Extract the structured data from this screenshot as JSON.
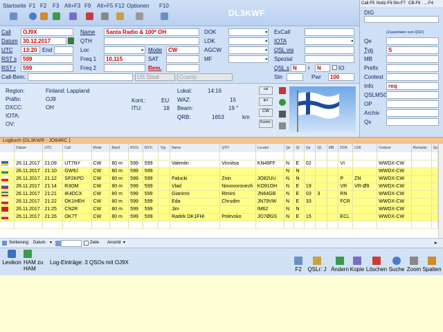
{
  "menu": {
    "items": [
      "Startseite",
      "F1",
      "F2",
      "F3",
      "Alt+F3",
      "F9",
      "Alt+F5",
      "F12",
      "Optionen",
      "F10"
    ]
  },
  "station_callsign": "DL3KWF",
  "form": {
    "call": {
      "label": "Call",
      "value": "OJ9X"
    },
    "datum": {
      "label": "Datum",
      "value": "30.12.2017"
    },
    "utc": {
      "label": "UTC",
      "value": "13:20",
      "end_label": "End"
    },
    "rst_s": {
      "label": "RST s",
      "value": "599"
    },
    "rst_r": {
      "label": "RST r",
      "value": "599"
    },
    "call_bem": {
      "label": "Call-Bem.",
      "value": ""
    },
    "name": {
      "label": "Name",
      "value": "Santa Radio & 100* OH"
    },
    "qth": {
      "label": "QTH",
      "value": ""
    },
    "loc": {
      "label": "Loc",
      "value": ""
    },
    "freq1": {
      "label": "Freq 1",
      "value": "10,115"
    },
    "freq2": {
      "label": "Freq 2",
      "value": ""
    },
    "mode": {
      "label": "Mode",
      "value": "CW"
    },
    "sat": {
      "label": "SAT",
      "value": ""
    },
    "rem": {
      "label": "Rem.",
      "value": ""
    },
    "dok": {
      "label": "DOK",
      "value": ""
    },
    "ldk": {
      "label": "LDK",
      "value": ""
    },
    "agcw": {
      "label": "AGCW",
      "value": ""
    },
    "mf": {
      "label": "MF",
      "value": ""
    },
    "us_staat": {
      "label": "US Staat"
    },
    "county": {
      "label": "County"
    },
    "excall": {
      "label": "ExCall",
      "value": ""
    },
    "iota": {
      "label": "IOTA",
      "value": ""
    },
    "qsl_via": {
      "label": "QSL via",
      "value": ""
    },
    "spezial": {
      "label": "Spezial",
      "value": ""
    },
    "qsl_s": {
      "label": "QSL s",
      "value": "N"
    },
    "qsl_r": {
      "label": "r",
      "value": "N"
    },
    "io_label": "IO",
    "stn": {
      "label": "Stn",
      "value": ""
    },
    "pwr": {
      "label": "Pwr",
      "value": "100"
    }
  },
  "right_panel": {
    "tabs": [
      "Call-F5",
      "Notiz-F6",
      "Stn-F7",
      "CB-F8",
      "...-F4"
    ],
    "dig_label": "DIG",
    "zusatz_label": "(Zusatzdaten zum QSO)",
    "fields": [
      {
        "label": "Qe",
        "value": ""
      },
      {
        "label": "Typ",
        "value": "S"
      },
      {
        "label": "MB",
        "value": ""
      },
      {
        "label": "Prefix",
        "value": ""
      },
      {
        "label": "Contest",
        "value": ""
      },
      {
        "label": "Info",
        "value": "req"
      },
      {
        "label": "QSLMSG",
        "value": ""
      },
      {
        "label": "OP",
        "value": ""
      },
      {
        "label": "Archiv",
        "value": ""
      },
      {
        "label": "Qx",
        "value": ""
      }
    ]
  },
  "info": {
    "region_label": "Region:",
    "region": "Finland: Lappland",
    "praefix_label": "Präfix:",
    "praefix": "OJ9",
    "dxcc_label": "DXCC:",
    "dxcc": "OH",
    "iota_label": "IOTA:",
    "ov_label": "OV:",
    "kont_label": "Kont.:",
    "kont": "EU",
    "itu_label": "ITU:",
    "itu": "18",
    "lokal_label": "Lokal:",
    "lokal": "14:16",
    "waz_label": "WAZ:",
    "waz": "15",
    "beam_label": "Beam:",
    "beam": "19 °",
    "qrb_label": "QRB:",
    "qrb": "1653",
    "qrb_unit": "km",
    "side_buttons": [
      "cal",
      "qrz",
      "CW",
      "Komm."
    ]
  },
  "log": {
    "title": "Logbuch  (DL3KWR - JO64RC )",
    "columns": [
      "",
      "Datum",
      "UTC",
      "Call",
      "Mode",
      "Band",
      "RSTs",
      "RSTr",
      "Typ",
      "Name",
      "QTH",
      "Locator",
      "Qs",
      "Qr",
      "Qe",
      "Q1",
      "MB",
      "DOK",
      "LDK",
      "Contest",
      "Remarks",
      "Spezi"
    ],
    "rows": [
      [
        "",
        "",
        "",
        "",
        "",
        "",
        "",
        "",
        "",
        "",
        "",
        "",
        "",
        "",
        "",
        "",
        "",
        "",
        "",
        "",
        "",
        ""
      ],
      [
        "",
        "26.11.2017",
        "21:09",
        "UT7NY",
        "CW",
        "80 m",
        "599",
        "599",
        "",
        "Valentin",
        "Vinnitsa",
        "KN49FF",
        "N",
        "E",
        "02",
        "",
        "",
        "VI",
        "",
        "WWDX-CW",
        "",
        ""
      ],
      [
        "",
        "26.11.2017",
        "21:10",
        "GW9J",
        "CW",
        "80 m",
        "599",
        "599",
        "",
        "",
        "",
        "",
        "N",
        "N",
        "",
        "",
        "",
        "",
        "",
        "WWDX-CW",
        "",
        ""
      ],
      [
        "",
        "26.11.2017",
        "21:12",
        "SP2KPD",
        "CW",
        "80 m",
        "599",
        "599",
        "",
        "Palucki",
        "Znin",
        "JO82UU",
        "N",
        "N",
        "",
        "",
        "",
        "P",
        "ZN",
        "WWDX-CW",
        "",
        ""
      ],
      [
        "",
        "26.11.2017",
        "21:14",
        "R3OM",
        "CW",
        "80 m",
        "599",
        "599",
        "",
        "Vlad",
        "Novovoronezh",
        "KO91OH",
        "N",
        "E",
        "19",
        "",
        "",
        "VR",
        "VR-Ø9",
        "WWDX-CW",
        "",
        ""
      ],
      [
        "",
        "26.11.2017",
        "21:21",
        "IK4DCX",
        "CW",
        "80 m",
        "599",
        "599",
        "",
        "Gianinni",
        "Rimini",
        "JN64GB",
        "N",
        "E",
        "03",
        "3",
        "",
        "RN",
        "",
        "WWDX-CW",
        "",
        ""
      ],
      [
        "",
        "26.11.2017",
        "21:22",
        "OK1HEH",
        "CW",
        "80 m",
        "599",
        "599",
        "",
        "Eda",
        "Chrudim",
        "JN79VW",
        "N",
        "E",
        "33",
        "",
        "",
        "FCR",
        "",
        "WWDX-CW",
        "",
        ""
      ],
      [
        "",
        "26.11.2017",
        "21:25",
        "CN2R",
        "CW",
        "80 m",
        "599",
        "599",
        "",
        "Jim",
        "",
        "IM62",
        "N",
        "N",
        "",
        "",
        "",
        "",
        "",
        "WWDX-CW",
        "",
        ""
      ],
      [
        "",
        "26.11.2017",
        "21:26",
        "OK7T",
        "CW",
        "80 m",
        "599",
        "599",
        "",
        "Radek OK1FHI",
        "Polevsko",
        "JO7ØGS",
        "N",
        "E",
        "15",
        "",
        "",
        "ECL",
        "",
        "WWDX-CW",
        "",
        ""
      ],
      [
        "",
        "",
        "",
        "",
        "",
        "",
        "",
        "",
        "",
        "",
        "",
        "",
        "",
        "",
        "",
        "",
        "",
        "",
        "",
        "",
        "",
        ""
      ]
    ],
    "flags": [
      "ua",
      "gb-wls",
      "pl",
      "ru",
      "it",
      "cz",
      "ma",
      "cz"
    ]
  },
  "sortbar": {
    "sortierung_label": "Sortierung:",
    "sort_value": "Datum",
    "zeile_label": "Zeile",
    "ansicht_label": "Ansicht"
  },
  "bottom": {
    "lexikon": "Lexikon",
    "ham_zu_ham": "HAM zu HAM",
    "status": "Log-Einträge: 3 QSOs mit OJ9X",
    "buttons": [
      "F2",
      "QSLr: J",
      "Ändern",
      "Kopie",
      "Löschen",
      "Suche",
      "Zoom",
      "Spalten"
    ]
  },
  "colors": {
    "form_bg": "#cfe0f6",
    "log_header": "#f6c38f",
    "row_highlight": "#ffff88",
    "value_red": "#cc0000"
  }
}
